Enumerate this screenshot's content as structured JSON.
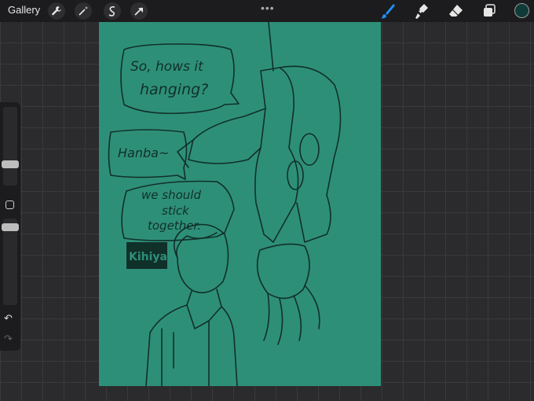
{
  "topbar": {
    "gallery_label": "Gallery",
    "left_tools": [
      "wrench-icon",
      "magic-wand-icon",
      "selection-icon",
      "transform-arrow-icon"
    ],
    "center_menu": "•••",
    "right_tools": [
      "brush-icon",
      "smudge-icon",
      "eraser-icon",
      "layers-icon"
    ],
    "active_tool": "brush-icon",
    "current_color": "#0f3a38",
    "active_color": "#1e90ff"
  },
  "canvas": {
    "background": "#2e8f78",
    "line_color": "#10302a",
    "speech_bubbles": [
      {
        "lines": [
          "So, hows it",
          "hanging?"
        ]
      },
      {
        "lines": [
          "Hanba~"
        ]
      },
      {
        "lines": [
          "we should",
          "stick",
          "together."
        ]
      }
    ],
    "signature": "Kihiya"
  },
  "sidebar": {
    "controls": [
      "brush-size-slider",
      "modify-button",
      "opacity-slider",
      "undo-icon",
      "redo-icon"
    ],
    "undo_symbol": "↶",
    "redo_symbol": "↷"
  }
}
